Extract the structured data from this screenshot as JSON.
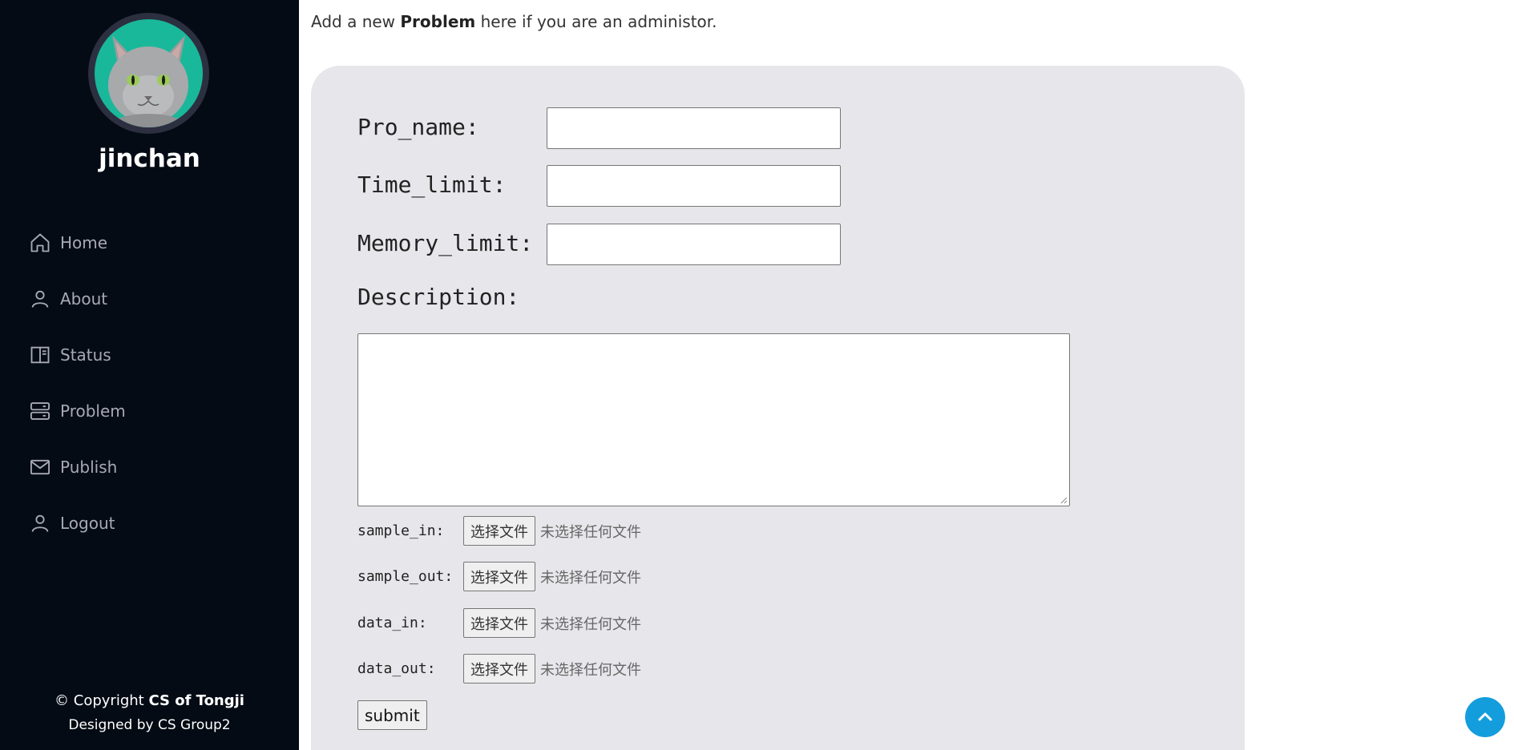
{
  "sidebar": {
    "username": "jinchan",
    "items": [
      {
        "label": "Home",
        "icon": "home-icon"
      },
      {
        "label": "About",
        "icon": "person-icon"
      },
      {
        "label": "Status",
        "icon": "layout-icon"
      },
      {
        "label": "Problem",
        "icon": "server-icon"
      },
      {
        "label": "Publish",
        "icon": "envelope-icon"
      },
      {
        "label": "Logout",
        "icon": "person-icon"
      }
    ],
    "footer": {
      "copyright_prefix": "© Copyright ",
      "copyright_org": "CS of Tongji",
      "designed": "Designed by CS Group2"
    }
  },
  "main": {
    "intro": {
      "before": "Add a new ",
      "bold": "Problem",
      "after": " here if you are an administor."
    },
    "form": {
      "pro_name_label": "Pro_name:",
      "pro_name_value": "",
      "time_limit_label": "Time_limit:",
      "time_limit_value": "",
      "memory_limit_label": "Memory_limit:",
      "memory_limit_value": "",
      "description_label": "Description:",
      "description_value": "",
      "files": [
        {
          "label": "sample_in:",
          "button": "选择文件",
          "status": "未选择任何文件"
        },
        {
          "label": "sample_out:",
          "button": "选择文件",
          "status": "未选择任何文件"
        },
        {
          "label": "data_in:",
          "button": "选择文件",
          "status": "未选择任何文件"
        },
        {
          "label": "data_out:",
          "button": "选择文件",
          "status": "未选择任何文件"
        }
      ],
      "submit_label": "submit"
    }
  },
  "colors": {
    "sidebar_bg": "#040b14",
    "panel_bg": "#e7e6ea",
    "accent": "#149ddd",
    "avatar_bg": "#19b89a"
  }
}
